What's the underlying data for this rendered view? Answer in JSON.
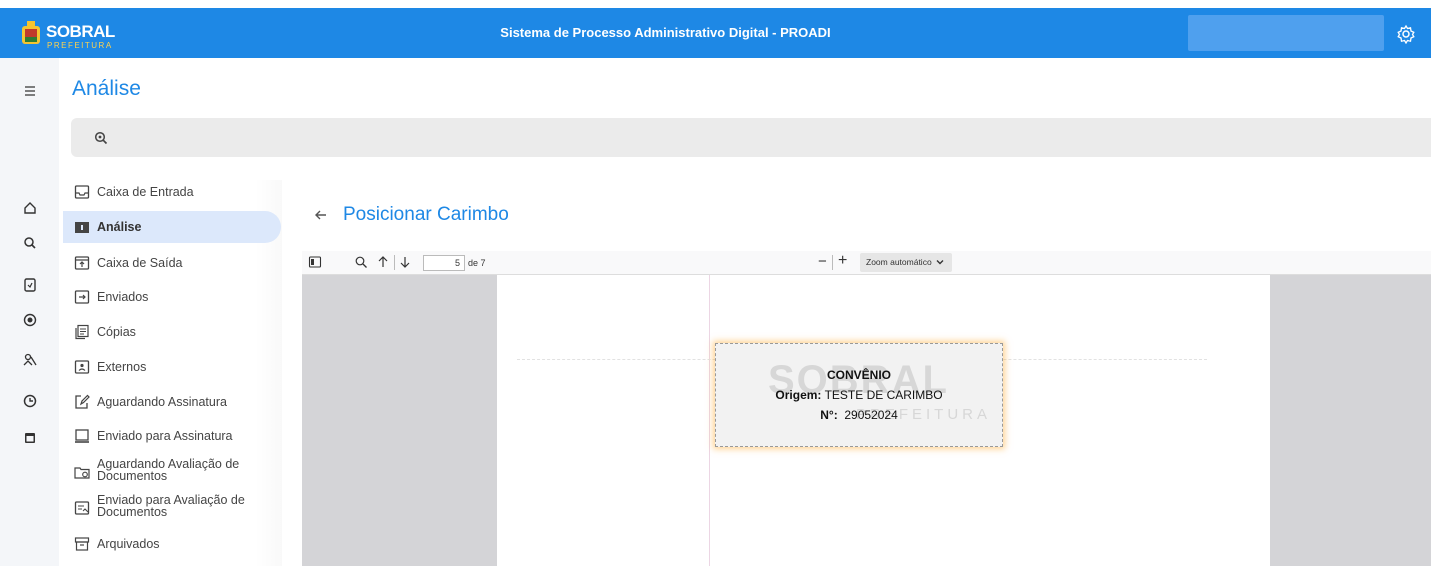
{
  "topbar": {
    "brand_name": "SOBRAL",
    "brand_sub": "PREFEITURA",
    "system_title": "Sistema de Processo Administrativo Digital - PROADI",
    "settings_icon": "gear-icon",
    "colors": {
      "bar": "#1e88e5",
      "accent_yellow": "#ffd24d"
    }
  },
  "rail": {
    "menu_icon": "hamburger-icon",
    "icons": [
      "home-icon",
      "search-icon",
      "document-icon",
      "radio-icon",
      "people-icon",
      "clock-icon",
      "archive-icon"
    ]
  },
  "page": {
    "title": "Análise"
  },
  "search": {
    "icon": "zoom-search-icon"
  },
  "menu": {
    "items": [
      {
        "label": "Caixa de Entrada",
        "icon": "inbox-icon"
      },
      {
        "label": "Análise",
        "icon": "folder-icon"
      },
      {
        "label": "Caixa de Saída",
        "icon": "outbox-icon"
      },
      {
        "label": "Enviados",
        "icon": "send-icon"
      },
      {
        "label": "Cópias",
        "icon": "copy-icon"
      },
      {
        "label": "Externos",
        "icon": "external-icon"
      },
      {
        "label": "Aguardando Assinatura",
        "icon": "sign-edit-icon"
      },
      {
        "label": "Enviado para Assinatura",
        "icon": "sign-sent-icon"
      },
      {
        "label": "Aguardando Avaliação de Documentos",
        "icon": "folder-pending-icon"
      },
      {
        "label": "Enviado para Avaliação de Documentos",
        "icon": "doc-review-icon"
      },
      {
        "label": "Arquivados",
        "icon": "archive-box-icon"
      }
    ]
  },
  "subheader": {
    "title": "Posicionar Carimbo",
    "back_icon": "arrow-left-icon"
  },
  "pdf_toolbar": {
    "current_page": "5",
    "page_count": "de 7",
    "zoom_out": "−",
    "zoom_in": "+",
    "zoom_value": "Zoom automático"
  },
  "stamp": {
    "title": "CONVÊNIO",
    "origin_label": "Origem:",
    "origin_value": "TESTE DE CARIMBO",
    "number_label": "N°:",
    "number_value": "29052024",
    "watermark": "SOBRAL",
    "watermark_sub": "PREFEITURA"
  }
}
